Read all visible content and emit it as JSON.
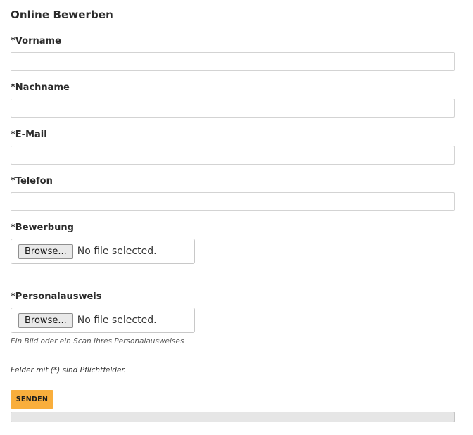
{
  "form": {
    "title": "Online Bewerben",
    "fields": {
      "vorname": {
        "label": "*Vorname",
        "value": ""
      },
      "nachname": {
        "label": "*Nachname",
        "value": ""
      },
      "email": {
        "label": "*E-Mail",
        "value": ""
      },
      "telefon": {
        "label": "*Telefon",
        "value": ""
      }
    },
    "uploads": {
      "bewerbung": {
        "label": "*Bewerbung",
        "button_label": "Browse...",
        "status": "No file selected."
      },
      "personalausweis": {
        "label": "*Personalausweis",
        "button_label": "Browse...",
        "status": "No file selected.",
        "hint": "Ein Bild oder ein Scan Ihres Personalausweises"
      }
    },
    "required_note": "Felder mit (*) sind Pflichtfelder.",
    "submit_label": "SENDEN",
    "progress": 0
  },
  "colors": {
    "accent": "#f9ae3c",
    "progress_track": "#e6e6e6",
    "input_border": "#d3d3d3"
  }
}
